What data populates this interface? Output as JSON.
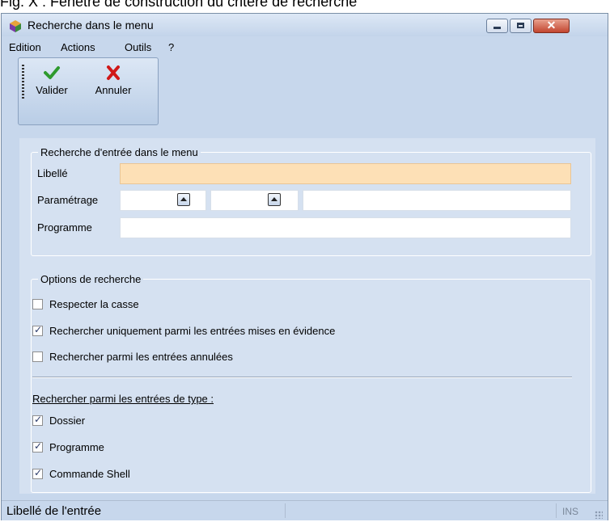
{
  "caption": "Fig. X : Fenêtre de construction du critère de recherche",
  "window": {
    "title": "Recherche dans le menu",
    "controls": {
      "minimize": "minimize-icon",
      "maximize": "maximize-icon",
      "close": "close-icon"
    }
  },
  "menu": [
    "Edition",
    "Actions",
    "Outils",
    "?"
  ],
  "toolbar": {
    "valider": "Valider",
    "annuler": "Annuler",
    "valider_color": "#2e9a2e",
    "annuler_color": "#d01818"
  },
  "search_group": {
    "legend": "Recherche d'entrée dans le menu",
    "libelle_label": "Libellé",
    "libelle_value": "",
    "parametrage_label": "Paramétrage",
    "parametrage_values": [
      "",
      "",
      ""
    ],
    "programme_label": "Programme",
    "programme_value": ""
  },
  "options_group": {
    "legend": "Options de recherche",
    "options": [
      {
        "label": "Respecter la casse",
        "checked": false
      },
      {
        "label": "Rechercher uniquement parmi les entrées mises en évidence",
        "checked": true
      },
      {
        "label": "Rechercher parmi les entrées annulées",
        "checked": false
      }
    ],
    "types_label": "Rechercher parmi les entrées de type :",
    "types": [
      {
        "label": "Dossier",
        "checked": true
      },
      {
        "label": "Programme",
        "checked": true
      },
      {
        "label": "Commande Shell",
        "checked": true
      }
    ]
  },
  "status": {
    "text": "Libellé de l'entrée",
    "mode": "INS"
  },
  "colors": {
    "window_bg": "#c7d7ec",
    "panel_bg": "#d5e1f1",
    "active_field": "#fde0b6"
  }
}
